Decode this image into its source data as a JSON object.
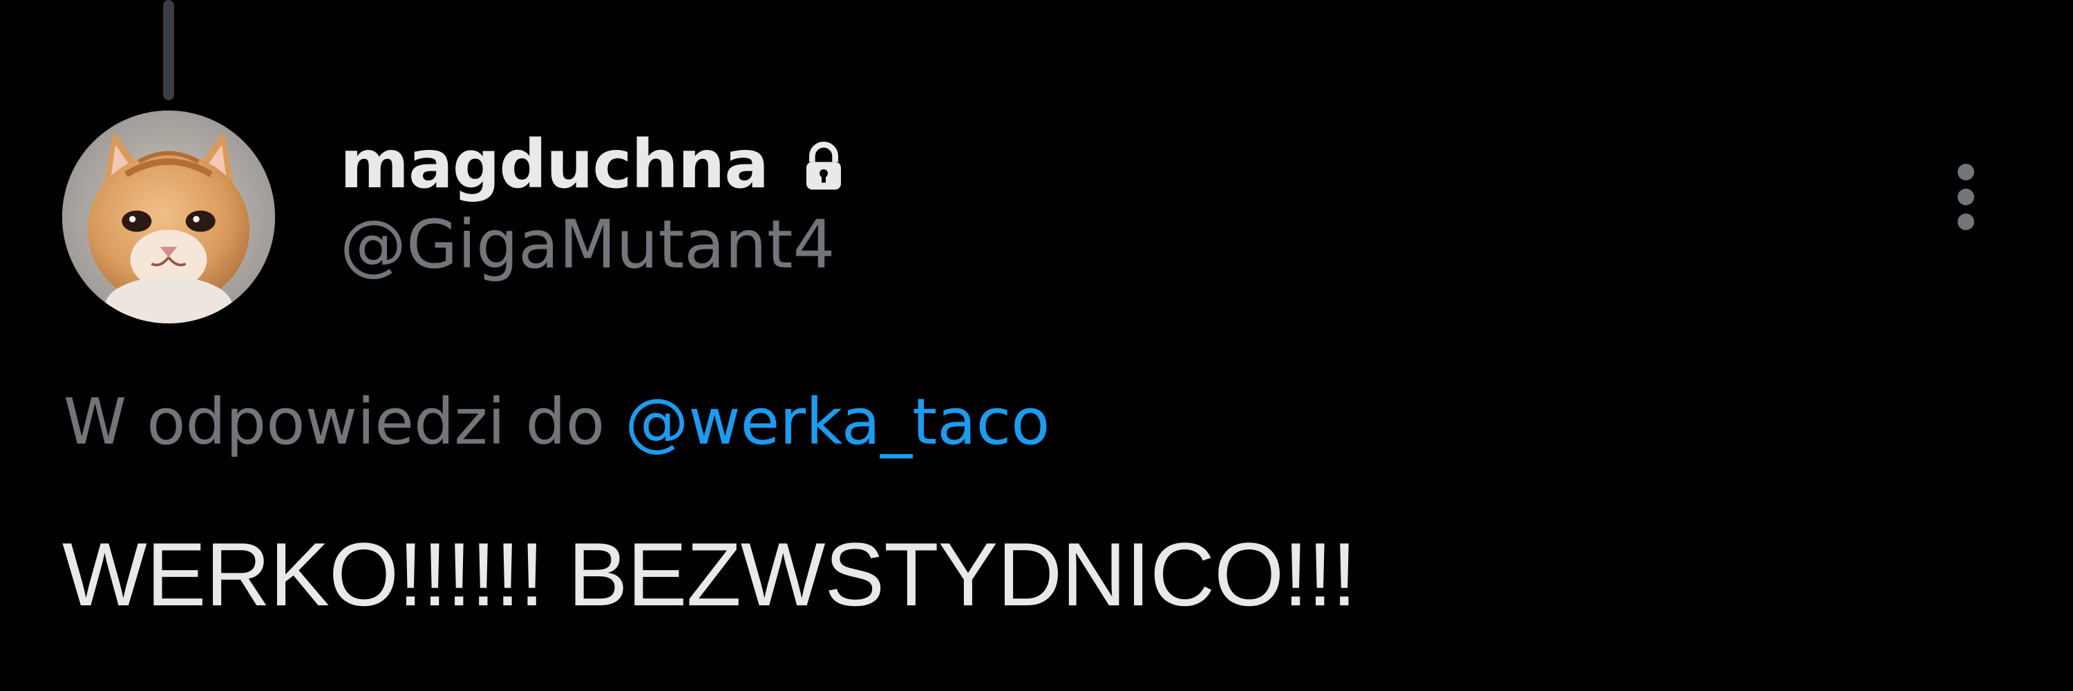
{
  "tweet": {
    "author": {
      "display_name": "magduchna",
      "handle": "@GigaMutant4",
      "protected_icon": "lock-icon",
      "avatar": "kitten-photo"
    },
    "more_icon": "more-vertical-icon",
    "reply_context": {
      "prefix": "W odpowiedzi do ",
      "mention": "@werka_taco"
    },
    "text": "WERKO!!!!!! BEZWSTYDNICO!!!"
  },
  "colors": {
    "background": "#000000",
    "primary_text": "#e7e9ea",
    "secondary_text": "#71767b",
    "link": "#1d9bf0"
  }
}
